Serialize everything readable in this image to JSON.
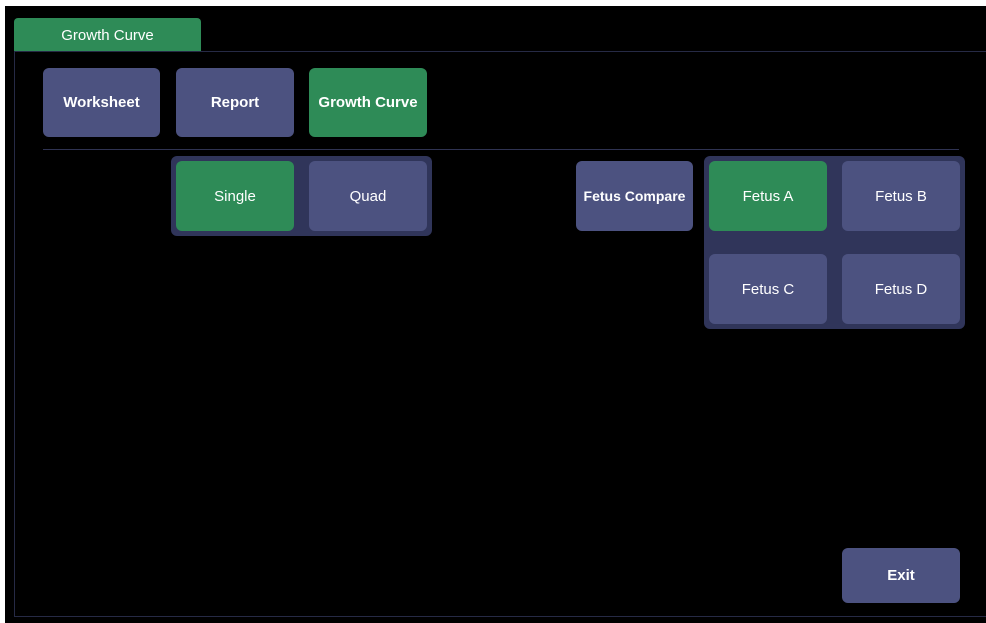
{
  "tabs": [
    {
      "label": "Growth Curve",
      "active": true
    }
  ],
  "nav": {
    "worksheet": "Worksheet",
    "report": "Report",
    "growth_curve": "Growth Curve",
    "active": "growth_curve"
  },
  "layout_mode": {
    "single": "Single",
    "quad": "Quad",
    "selected": "Single"
  },
  "fetus": {
    "compare_label": "Fetus Compare",
    "options": [
      "Fetus A",
      "Fetus B",
      "Fetus C",
      "Fetus D"
    ],
    "selected": "Fetus A"
  },
  "footer": {
    "exit_label": "Exit"
  },
  "colors": {
    "background": "#000000",
    "button": "#4c5280",
    "selected": "#2e8b57",
    "group": "#30355a"
  }
}
